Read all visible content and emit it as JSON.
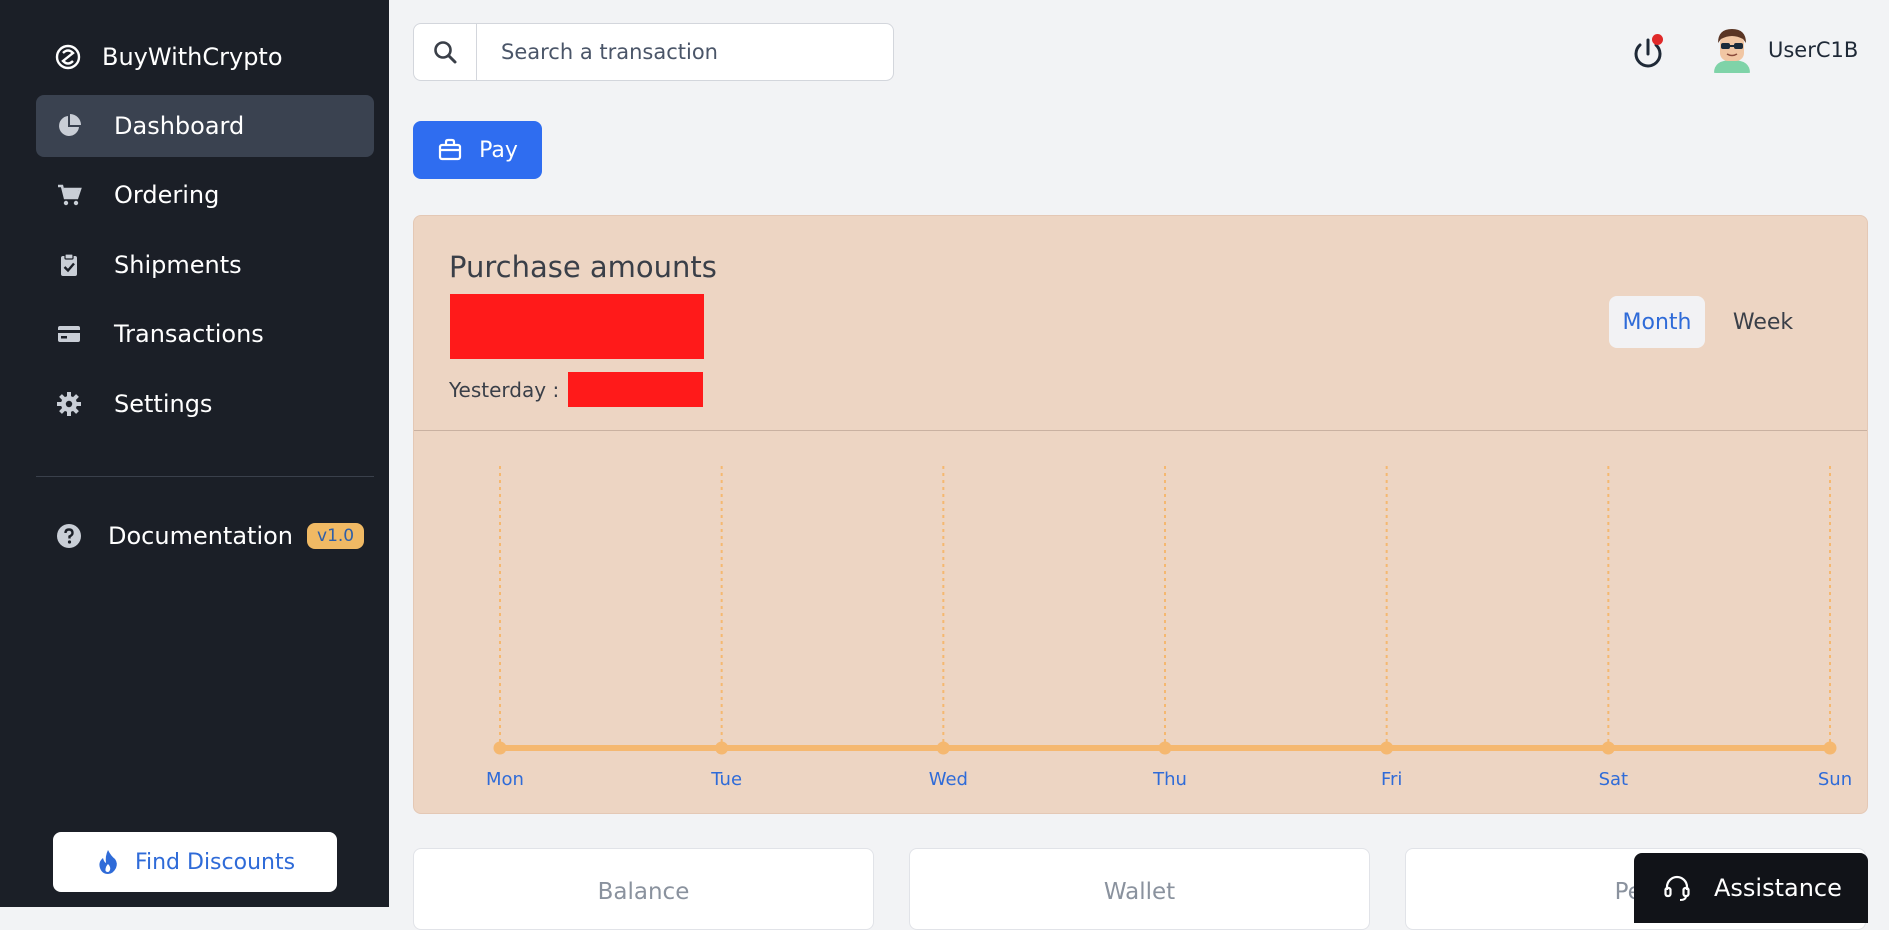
{
  "app": {
    "name": "BuyWithCrypto"
  },
  "sidebar": {
    "items": [
      {
        "label": "Dashboard",
        "icon": "pie-chart-icon",
        "active": true
      },
      {
        "label": "Ordering",
        "icon": "cart-icon"
      },
      {
        "label": "Shipments",
        "icon": "clipboard-check-icon"
      },
      {
        "label": "Transactions",
        "icon": "credit-card-icon"
      },
      {
        "label": "Settings",
        "icon": "gear-icon"
      }
    ],
    "documentation": {
      "label": "Documentation",
      "badge": "v1.0",
      "icon": "question-circle-icon"
    },
    "discount_button": {
      "label": "Find Discounts",
      "icon": "fire-icon"
    }
  },
  "header": {
    "search": {
      "placeholder": "Search a transaction",
      "icon": "search-icon"
    },
    "notification_dot": true,
    "user": {
      "name": "UserC1B"
    }
  },
  "actions": {
    "pay_label": "Pay"
  },
  "purchase_card": {
    "title": "Purchase amounts",
    "yesterday_label": "Yesterday :",
    "toggle": {
      "month": "Month",
      "week": "Week",
      "selected": "Month"
    }
  },
  "chart_data": {
    "type": "line",
    "categories": [
      "Mon",
      "Tue",
      "Wed",
      "Thu",
      "Fri",
      "Sat",
      "Sun"
    ],
    "series": [
      {
        "values": [
          0,
          0,
          0,
          0,
          0,
          0,
          0
        ],
        "color": "#f5b870"
      }
    ],
    "gridlines": "vertical-dotted",
    "axis_label_color": "#2f6bd8"
  },
  "summary_cards": [
    "Balance",
    "Wallet",
    "Pen"
  ],
  "assistance": {
    "label": "Assistance",
    "icon": "headset-icon"
  },
  "colors": {
    "sidebar_bg": "#1b1f27",
    "accent_blue": "#2f6df0",
    "card_bg": "#edd5c3",
    "line_orange": "#f5b870",
    "badge_bg": "#f0b964",
    "notification_red": "#e02929"
  }
}
